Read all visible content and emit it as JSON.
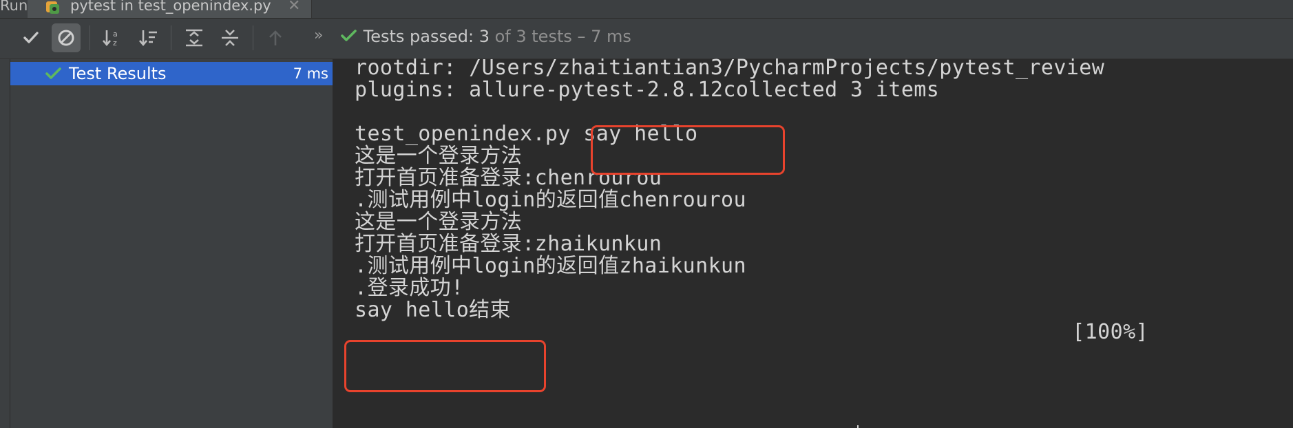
{
  "run_window": {
    "label": "Run:",
    "tab": {
      "title": "pytest in test_openindex.py",
      "close": "✕"
    }
  },
  "toolbar": {
    "buttons": [
      {
        "name": "show-passed-button",
        "icon": "check-icon",
        "active": false
      },
      {
        "name": "show-ignored-button",
        "icon": "forbidden-icon",
        "active": true
      },
      {
        "name": "sort-alphabetically-button",
        "icon": "sort-alpha-icon",
        "active": false
      },
      {
        "name": "sort-by-duration-button",
        "icon": "sort-duration-icon",
        "active": false
      },
      {
        "name": "expand-all-button",
        "icon": "expand-all-icon",
        "active": false
      },
      {
        "name": "collapse-all-button",
        "icon": "collapse-all-icon",
        "active": false
      },
      {
        "name": "previous-failed-button",
        "icon": "arrow-up-icon",
        "active": false
      }
    ],
    "more": "»",
    "status": {
      "prefix": "Tests passed: ",
      "passed": "3",
      "suffix": " of 3 tests – 7 ms"
    }
  },
  "tree": {
    "root": {
      "label": "Test Results",
      "duration": "7 ms",
      "status_icon": "check-icon"
    }
  },
  "console": {
    "lines": [
      "rootdir: /Users/zhaitiantian3/PycharmProjects/pytest_review",
      "plugins: allure-pytest-2.8.12collected 3 items",
      "",
      "test_openindex.py say hello",
      "这是一个登录方法",
      "打开首页准备登录:chenrourou",
      ".测试用例中login的返回值chenrourou",
      "这是一个登录方法",
      "打开首页准备登录:zhaikunkun",
      ".测试用例中login的返回值zhaikunkun",
      ".登录成功!",
      "say hello结束"
    ],
    "progress": "[100%]"
  },
  "colors": {
    "pass_green": "#5fb95f",
    "highlight": "#e8432d",
    "selection": "#2f65ca"
  }
}
